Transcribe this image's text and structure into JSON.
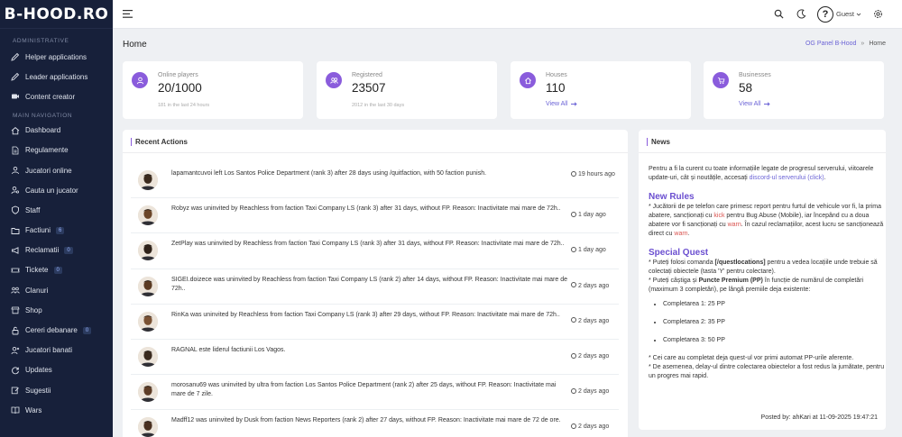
{
  "app": {
    "logo": "B-HOOD.RO"
  },
  "sidebar": {
    "section_admin": "ADMINISTRATIVE",
    "section_main": "MAIN NAVIGATION",
    "admin_items": [
      {
        "label": "Helper applications",
        "icon": "pencil-icon"
      },
      {
        "label": "Leader applications",
        "icon": "pencil-icon"
      },
      {
        "label": "Content creator",
        "icon": "video-icon"
      }
    ],
    "main_items": [
      {
        "label": "Dashboard",
        "icon": "home-icon"
      },
      {
        "label": "Regulamente",
        "icon": "document-icon"
      },
      {
        "label": "Jucatori online",
        "icon": "users-icon"
      },
      {
        "label": "Cauta un jucator",
        "icon": "user-search-icon"
      },
      {
        "label": "Staff",
        "icon": "shield-icon"
      },
      {
        "label": "Factiuni",
        "icon": "folder-icon",
        "badge": "6"
      },
      {
        "label": "Reclamatii",
        "icon": "megaphone-icon",
        "badge": "0"
      },
      {
        "label": "Tickete",
        "icon": "ticket-icon",
        "badge": "0"
      },
      {
        "label": "Clanuri",
        "icon": "group-icon"
      },
      {
        "label": "Shop",
        "icon": "shop-icon"
      },
      {
        "label": "Cereri debanare",
        "icon": "unlock-icon",
        "badge": "0"
      },
      {
        "label": "Jucatori banati",
        "icon": "user-x-icon"
      },
      {
        "label": "Updates",
        "icon": "refresh-icon"
      },
      {
        "label": "Sugestii",
        "icon": "edit-icon"
      },
      {
        "label": "Wars",
        "icon": "book-icon"
      }
    ]
  },
  "topbar": {
    "user": "Guest"
  },
  "page": {
    "title": "Home",
    "breadcrumb_link": "OG Panel B-Hood",
    "breadcrumb_sep": "»",
    "breadcrumb_current": "Home"
  },
  "stats": [
    {
      "label": "Online players",
      "value": "20/1000",
      "sub": "181 in the last 24 hours"
    },
    {
      "label": "Registered",
      "value": "23507",
      "sub": "2012 in the last 30 days"
    },
    {
      "label": "Houses",
      "value": "110",
      "link": "View All"
    },
    {
      "label": "Businesses",
      "value": "58",
      "link": "View All"
    }
  ],
  "recent": {
    "title": "Recent Actions",
    "items": [
      {
        "text": "lapamantcuvoi left Los Santos Police Department (rank 3) after 28 days using /quitfaction, with 50 faction punish.",
        "time": "19 hours ago"
      },
      {
        "text": "Robyz was uninvited by Reachless from faction Taxi Company LS (rank 3) after 31 days, without FP. Reason: Inactivitate mai mare de 72h..",
        "time": "1 day ago"
      },
      {
        "text": "ZetPlay was uninvited by Reachless from faction Taxi Company LS (rank 3) after 31 days, without FP. Reason: Inactivitate mai mare de 72h..",
        "time": "1 day ago"
      },
      {
        "text": "SIGEI.doizece was uninvited by Reachless from faction Taxi Company LS (rank 2) after 14 days, without FP. Reason: Inactivitate mai mare de 72h..",
        "time": "2 days ago"
      },
      {
        "text": "RinKa was uninvited by Reachless from faction Taxi Company LS (rank 3) after 29 days, without FP. Reason: Inactivitate mai mare de 72h..",
        "time": "2 days ago"
      },
      {
        "text": "RAGNAL este liderul factiunii Los Vagos.",
        "time": "2 days ago"
      },
      {
        "text": "morosanu69 was uninvited by ultra from faction Los Santos Police Department (rank 2) after 25 days, without FP. Reason: Inactivitate mai mare de 7 zile.",
        "time": "2 days ago"
      },
      {
        "text": "Madff12 was uninvited by Dusk from faction News Reporters (rank 2) after 27 days, without FP. Reason: Inactivitate mai mare de 72 de ore.",
        "time": "2 days ago"
      }
    ]
  },
  "news": {
    "title": "News",
    "intro_1": "Pentru a fi la curent cu toate informațiile legate de progresul serverului, viitoarele update-uri, cât și noutățile, accesați ",
    "intro_link": "discord-ul serverului (click)",
    "intro_2": ".",
    "rules_heading": "New Rules",
    "rules_1": "* Jucătorii de pe telefon care primesc report pentru furtul de vehicule vor fi, la prima abatere, sancționați cu ",
    "rules_kick": "kick",
    "rules_2": " pentru Bug Abuse (Mobile), iar începând cu a doua abatere vor fi sancționați cu ",
    "rules_warn1": "warn",
    "rules_3": ". În cazul reclamațiilor, acest lucru se sancționează direct cu ",
    "rules_warn2": "warn",
    "rules_4": ".",
    "quest_heading": "Special Quest",
    "quest_1a": "* Puteți folosi comanda ",
    "quest_cmd": "[/questlocations]",
    "quest_1b": " pentru a vedea locațiile unde trebuie să colectați obiectele (tasta 'Y' pentru colectare).",
    "quest_2a": "* Puteți câștiga și ",
    "quest_premium": "Puncte Premium (PP)",
    "quest_2b": " în funcție de numărul de completări (maximum 3 completări), pe lângă premiile deja existente:",
    "quest_list": [
      "Completarea 1: 25 PP",
      "Completarea 2: 35 PP",
      "Completarea 3: 50 PP"
    ],
    "quest_3": "* Cei care au completat deja quest-ul vor primi automat PP-urile aferente.",
    "quest_4": "* De asemenea, delay-ul dintre colectarea obiectelor a fost redus la jumătate, pentru un progres mai rapid.",
    "footer": "Posted by: ahKari at 11-09-2025 19:47:21"
  },
  "colors": {
    "sidebar": "#17203a",
    "accent": "#8a5cdc",
    "link": "#6b63d6",
    "warn": "#d9534f"
  }
}
